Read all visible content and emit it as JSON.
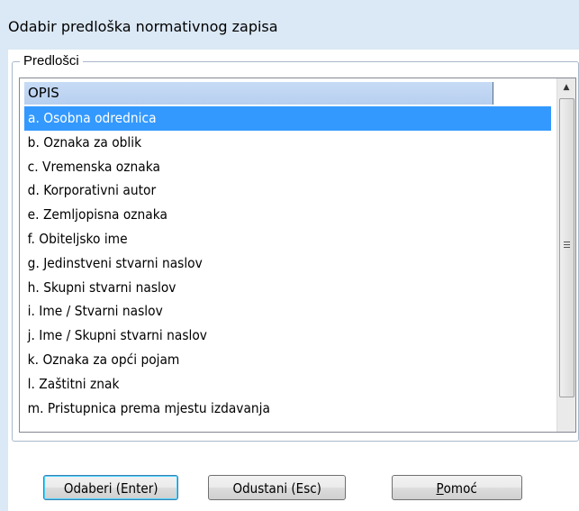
{
  "dialog": {
    "title": "Odabir predloška normativnog zapisa"
  },
  "group": {
    "label": "Predlošci"
  },
  "list": {
    "column_header": "OPIS",
    "items": [
      "a. Osobna odrednica",
      "b. Oznaka za oblik",
      "c. Vremenska oznaka",
      "d. Korporativni autor",
      "e. Zemljopisna oznaka",
      "f. Obiteljsko ime",
      "g. Jedinstveni stvarni naslov",
      "h. Skupni stvarni naslov",
      "i. Ime / Stvarni naslov",
      "j. Ime / Skupni stvarni naslov",
      "k. Oznaka za opći pojam",
      "l. Zaštitni znak",
      "m. Pristupnica prema mjestu izdavanja"
    ],
    "selected_index": 0
  },
  "buttons": {
    "select": "Odaberi (Enter)",
    "cancel": "Odustani (Esc)",
    "help_mnemonic": "P",
    "help_rest": "omoć"
  },
  "colors": {
    "background": "#dbe8f5",
    "selection": "#3399ff",
    "header": "#c1d7f3"
  },
  "icons": {
    "scroll_up": "triangle-up",
    "scroll_grip": "three-lines"
  }
}
